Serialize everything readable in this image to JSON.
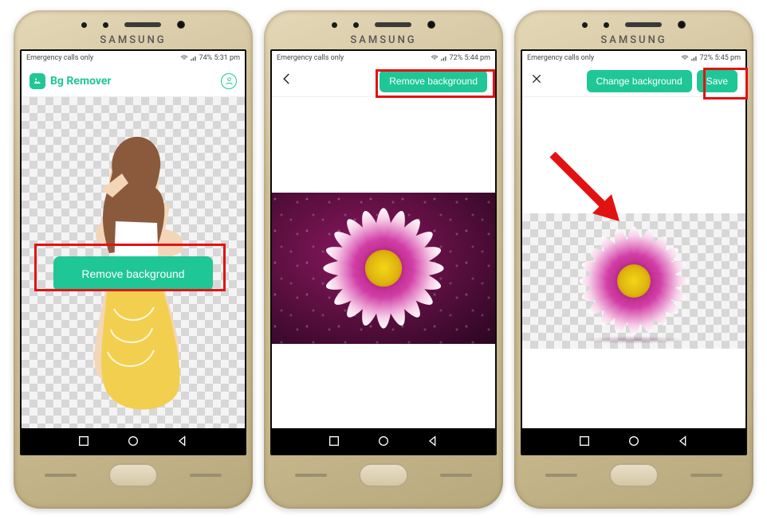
{
  "brand": "SAMSUNG",
  "screen1": {
    "status_left": "Emergency calls only",
    "status_right": "74%   5:31 pm",
    "app_title": "Bg Remover",
    "remove_button": "Remove background"
  },
  "screen2": {
    "status_left": "Emergency calls only",
    "status_right": "72%   5:44 pm",
    "remove_button": "Remove background"
  },
  "screen3": {
    "status_left": "Emergency calls only",
    "status_right": "72%   5:45 pm",
    "change_button": "Change background",
    "save_button": "Save"
  },
  "colors": {
    "accent": "#1fc796",
    "highlight": "#e31212"
  }
}
